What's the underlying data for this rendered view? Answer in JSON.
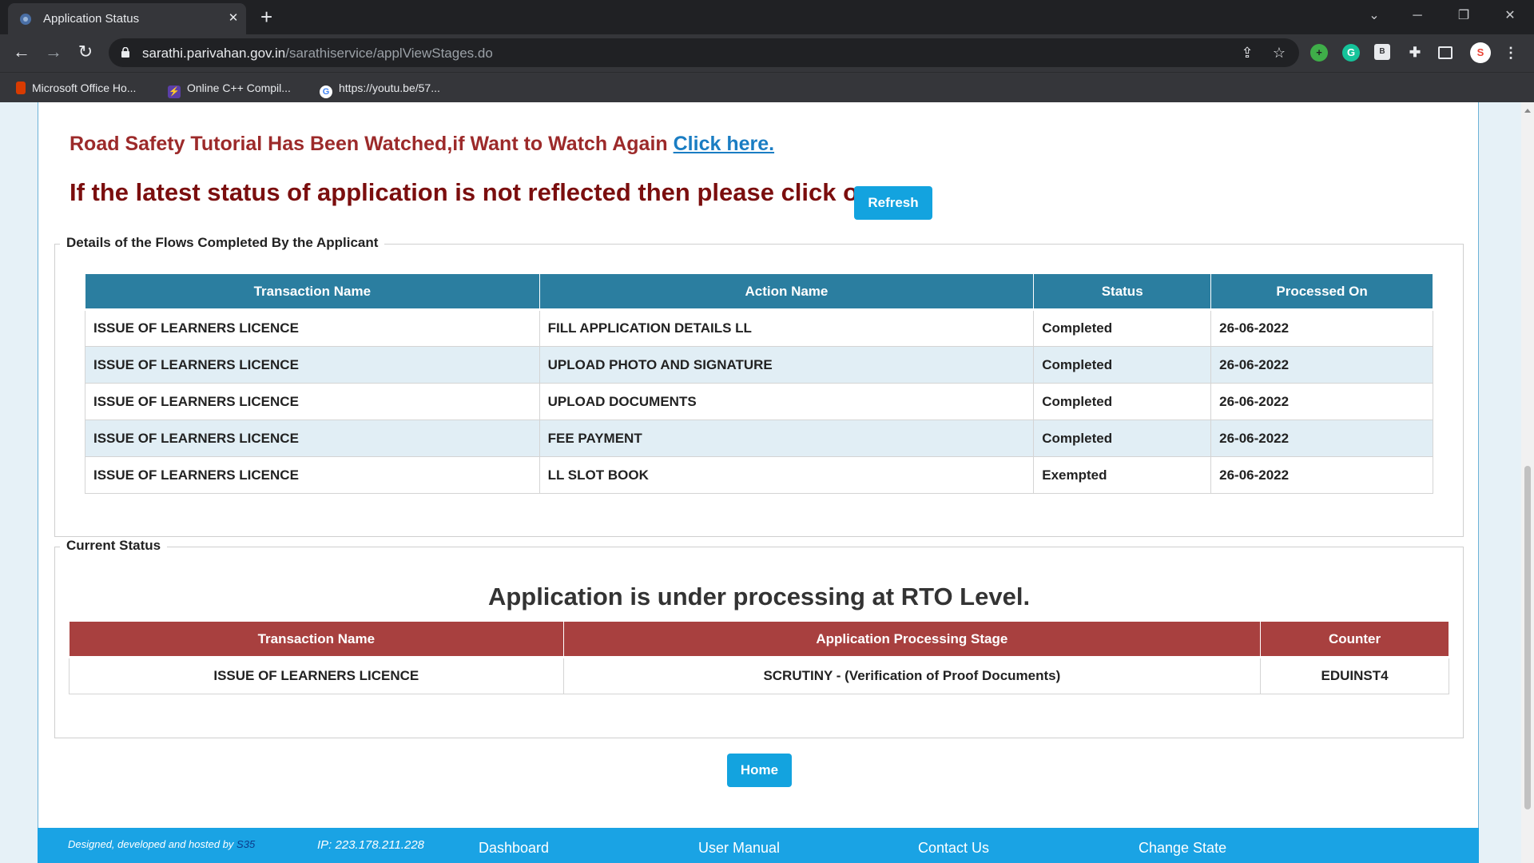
{
  "browser": {
    "tab_title": "Application Status",
    "url_domain": "sarathi.parivahan.gov.in",
    "url_path": "/sarathiservice/applViewStages.do",
    "bookmarks": [
      "Microsoft Office Ho...",
      "Online C++ Compil...",
      "https://youtu.be/57..."
    ]
  },
  "messages": {
    "tutorial_text": "Road Safety Tutorial Has Been Watched,if Want to Watch Again ",
    "tutorial_link": "Click here.",
    "refresh_prompt": "If the latest status of application is not reflected then please click on",
    "refresh_label": "Refresh"
  },
  "flows": {
    "legend": "Details of the Flows Completed By the Applicant",
    "headers": [
      "Transaction Name",
      "Action Name",
      "Status",
      "Processed On"
    ],
    "rows": [
      [
        "ISSUE OF LEARNERS LICENCE",
        "FILL APPLICATION DETAILS LL",
        "Completed",
        "26-06-2022"
      ],
      [
        "ISSUE OF LEARNERS LICENCE",
        "UPLOAD PHOTO AND SIGNATURE",
        "Completed",
        "26-06-2022"
      ],
      [
        "ISSUE OF LEARNERS LICENCE",
        "UPLOAD DOCUMENTS",
        "Completed",
        "26-06-2022"
      ],
      [
        "ISSUE OF LEARNERS LICENCE",
        "FEE PAYMENT",
        "Completed",
        "26-06-2022"
      ],
      [
        "ISSUE OF LEARNERS LICENCE",
        "LL SLOT BOOK",
        "Exempted",
        "26-06-2022"
      ]
    ]
  },
  "current": {
    "legend": "Current Status",
    "title": "Application is under processing at RTO Level.",
    "headers": [
      "Transaction Name",
      "Application Processing Stage",
      "Counter"
    ],
    "row": [
      "ISSUE OF LEARNERS LICENCE",
      "SCRUTINY - (Verification of Proof Documents)",
      "EDUINST4"
    ]
  },
  "home_label": "Home",
  "footer": {
    "designed_text": "Designed, developed and hosted by ",
    "designed_org": "S35",
    "ip_label": "IP: 223.178.211.228",
    "links": [
      "Dashboard",
      "User Manual",
      "Contact Us",
      "Change State"
    ]
  },
  "colors": {
    "flows_header": "#2b7ea0",
    "current_header": "#a8403f",
    "button": "#13a3df",
    "footer": "#1aa3e4"
  }
}
